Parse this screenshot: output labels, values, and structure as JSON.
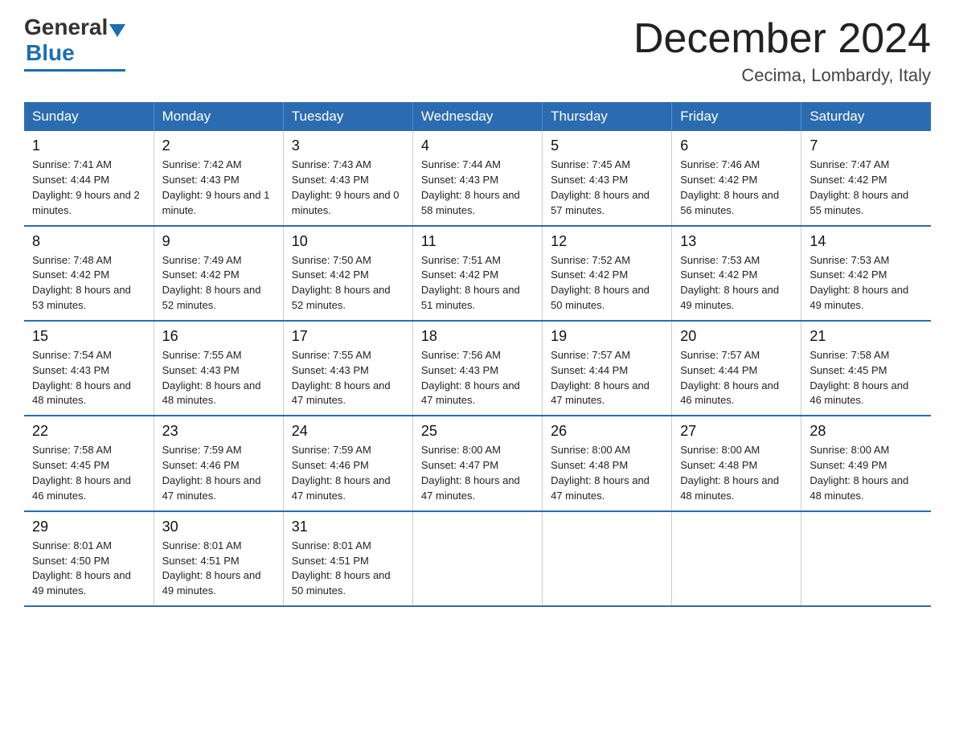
{
  "logo": {
    "general": "General",
    "blue": "Blue"
  },
  "title": "December 2024",
  "location": "Cecima, Lombardy, Italy",
  "days_of_week": [
    "Sunday",
    "Monday",
    "Tuesday",
    "Wednesday",
    "Thursday",
    "Friday",
    "Saturday"
  ],
  "weeks": [
    [
      {
        "day": "1",
        "sunrise": "7:41 AM",
        "sunset": "4:44 PM",
        "daylight": "9 hours and 2 minutes."
      },
      {
        "day": "2",
        "sunrise": "7:42 AM",
        "sunset": "4:43 PM",
        "daylight": "9 hours and 1 minute."
      },
      {
        "day": "3",
        "sunrise": "7:43 AM",
        "sunset": "4:43 PM",
        "daylight": "9 hours and 0 minutes."
      },
      {
        "day": "4",
        "sunrise": "7:44 AM",
        "sunset": "4:43 PM",
        "daylight": "8 hours and 58 minutes."
      },
      {
        "day": "5",
        "sunrise": "7:45 AM",
        "sunset": "4:43 PM",
        "daylight": "8 hours and 57 minutes."
      },
      {
        "day": "6",
        "sunrise": "7:46 AM",
        "sunset": "4:42 PM",
        "daylight": "8 hours and 56 minutes."
      },
      {
        "day": "7",
        "sunrise": "7:47 AM",
        "sunset": "4:42 PM",
        "daylight": "8 hours and 55 minutes."
      }
    ],
    [
      {
        "day": "8",
        "sunrise": "7:48 AM",
        "sunset": "4:42 PM",
        "daylight": "8 hours and 53 minutes."
      },
      {
        "day": "9",
        "sunrise": "7:49 AM",
        "sunset": "4:42 PM",
        "daylight": "8 hours and 52 minutes."
      },
      {
        "day": "10",
        "sunrise": "7:50 AM",
        "sunset": "4:42 PM",
        "daylight": "8 hours and 52 minutes."
      },
      {
        "day": "11",
        "sunrise": "7:51 AM",
        "sunset": "4:42 PM",
        "daylight": "8 hours and 51 minutes."
      },
      {
        "day": "12",
        "sunrise": "7:52 AM",
        "sunset": "4:42 PM",
        "daylight": "8 hours and 50 minutes."
      },
      {
        "day": "13",
        "sunrise": "7:53 AM",
        "sunset": "4:42 PM",
        "daylight": "8 hours and 49 minutes."
      },
      {
        "day": "14",
        "sunrise": "7:53 AM",
        "sunset": "4:42 PM",
        "daylight": "8 hours and 49 minutes."
      }
    ],
    [
      {
        "day": "15",
        "sunrise": "7:54 AM",
        "sunset": "4:43 PM",
        "daylight": "8 hours and 48 minutes."
      },
      {
        "day": "16",
        "sunrise": "7:55 AM",
        "sunset": "4:43 PM",
        "daylight": "8 hours and 48 minutes."
      },
      {
        "day": "17",
        "sunrise": "7:55 AM",
        "sunset": "4:43 PM",
        "daylight": "8 hours and 47 minutes."
      },
      {
        "day": "18",
        "sunrise": "7:56 AM",
        "sunset": "4:43 PM",
        "daylight": "8 hours and 47 minutes."
      },
      {
        "day": "19",
        "sunrise": "7:57 AM",
        "sunset": "4:44 PM",
        "daylight": "8 hours and 47 minutes."
      },
      {
        "day": "20",
        "sunrise": "7:57 AM",
        "sunset": "4:44 PM",
        "daylight": "8 hours and 46 minutes."
      },
      {
        "day": "21",
        "sunrise": "7:58 AM",
        "sunset": "4:45 PM",
        "daylight": "8 hours and 46 minutes."
      }
    ],
    [
      {
        "day": "22",
        "sunrise": "7:58 AM",
        "sunset": "4:45 PM",
        "daylight": "8 hours and 46 minutes."
      },
      {
        "day": "23",
        "sunrise": "7:59 AM",
        "sunset": "4:46 PM",
        "daylight": "8 hours and 47 minutes."
      },
      {
        "day": "24",
        "sunrise": "7:59 AM",
        "sunset": "4:46 PM",
        "daylight": "8 hours and 47 minutes."
      },
      {
        "day": "25",
        "sunrise": "8:00 AM",
        "sunset": "4:47 PM",
        "daylight": "8 hours and 47 minutes."
      },
      {
        "day": "26",
        "sunrise": "8:00 AM",
        "sunset": "4:48 PM",
        "daylight": "8 hours and 47 minutes."
      },
      {
        "day": "27",
        "sunrise": "8:00 AM",
        "sunset": "4:48 PM",
        "daylight": "8 hours and 48 minutes."
      },
      {
        "day": "28",
        "sunrise": "8:00 AM",
        "sunset": "4:49 PM",
        "daylight": "8 hours and 48 minutes."
      }
    ],
    [
      {
        "day": "29",
        "sunrise": "8:01 AM",
        "sunset": "4:50 PM",
        "daylight": "8 hours and 49 minutes."
      },
      {
        "day": "30",
        "sunrise": "8:01 AM",
        "sunset": "4:51 PM",
        "daylight": "8 hours and 49 minutes."
      },
      {
        "day": "31",
        "sunrise": "8:01 AM",
        "sunset": "4:51 PM",
        "daylight": "8 hours and 50 minutes."
      },
      null,
      null,
      null,
      null
    ]
  ]
}
